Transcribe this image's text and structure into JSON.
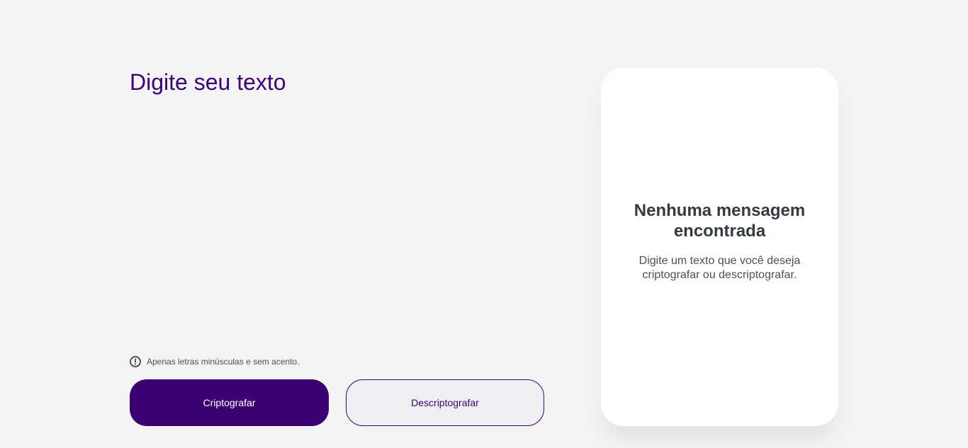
{
  "input": {
    "placeholder": "Digite seu texto",
    "value": ""
  },
  "hint": {
    "icon": "exclamation-circle-icon",
    "text": "Apenas letras minúsculas e sem acento."
  },
  "buttons": {
    "encrypt_label": "Criptografar",
    "decrypt_label": "Descriptografar"
  },
  "output": {
    "title": "Nenhuma mensagem encontrada",
    "text": "Digite um texto que você deseja criptografar ou descriptografar."
  },
  "colors": {
    "background": "#f3f3f3",
    "accent": "#3c0171",
    "card": "#ffffff",
    "title_text": "#343a40",
    "body_text": "#495057"
  }
}
